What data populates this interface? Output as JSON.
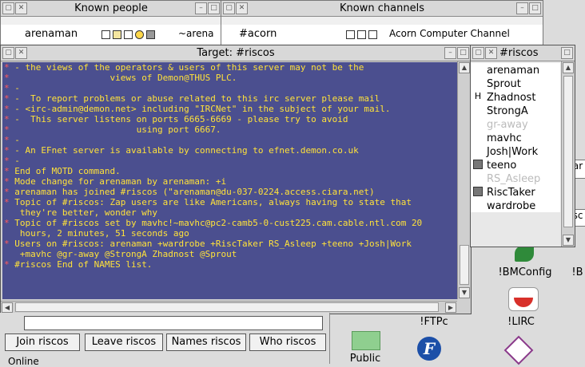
{
  "known_people": {
    "title": "Known people",
    "name": "arenaman",
    "nick_tail": "~arena"
  },
  "known_channels": {
    "title": "Known channels",
    "channel": "#acorn",
    "topic": "Acorn Computer Channel"
  },
  "target": {
    "title": "Target: #riscos"
  },
  "log_lines": [
    {
      "mark": "*",
      "text": " - the views of the operators & users of this server may not be the"
    },
    {
      "mark": "*",
      "text": "                   views of Demon@THUS PLC."
    },
    {
      "mark": "*",
      "text": " -"
    },
    {
      "mark": "*",
      "text": " -  To report problems or abuse related to this irc server please mail"
    },
    {
      "mark": "*",
      "text": " - <irc-admin@demon.net> including \"IRCNet\" in the subject of your mail."
    },
    {
      "mark": "*",
      "text": " -  This server listens on ports 6665-6669 - please try to avoid"
    },
    {
      "mark": "*",
      "text": "                        using port 6667."
    },
    {
      "mark": "*",
      "text": " -"
    },
    {
      "mark": "*",
      "text": " - An EFnet server is available by connecting to efnet.demon.co.uk"
    },
    {
      "mark": "*",
      "text": " -"
    },
    {
      "mark": "*",
      "text": " End of MOTD command."
    },
    {
      "mark": "*",
      "text": " Mode change for arenaman by arenaman: +i"
    },
    {
      "mark": "*",
      "text": " arenaman has joined #riscos (\"arenaman@du-037-0224.access.ciara.net)"
    },
    {
      "mark": "*",
      "text": " Topic of #riscos: Zap users are like Americans, always having to state that"
    },
    {
      "mark": "",
      "text": "   they're better, wonder why"
    },
    {
      "mark": "*",
      "text": " Topic of #riscos set by mavhc!~mavhc@pc2-camb5-0-cust225.cam.cable.ntl.com 20"
    },
    {
      "mark": "",
      "text": "   hours, 2 minutes, 51 seconds ago"
    },
    {
      "mark": "*",
      "text": " Users on #riscos: arenaman +wardrobe +RiscTaker RS_Asleep +teeno +Josh|Work"
    },
    {
      "mark": "",
      "text": "   +mavhc @gr-away @StrongA Zhadnost @Sprout"
    },
    {
      "mark": "*",
      "text": " #riscos End of NAMES list."
    }
  ],
  "users_panel": {
    "title": "#riscos"
  },
  "users": [
    {
      "name": "arenaman",
      "faint": false,
      "icon": ""
    },
    {
      "name": "Sprout",
      "faint": false,
      "icon": ""
    },
    {
      "name": "Zhadnost",
      "faint": false,
      "icon": "H"
    },
    {
      "name": "StrongA",
      "faint": false,
      "icon": ""
    },
    {
      "name": "gr-away",
      "faint": true,
      "icon": ""
    },
    {
      "name": "mavhc",
      "faint": false,
      "icon": ""
    },
    {
      "name": "Josh|Work",
      "faint": false,
      "icon": ""
    },
    {
      "name": "teeno",
      "faint": false,
      "icon": "monitor"
    },
    {
      "name": "RS_Asleep",
      "faint": true,
      "icon": ""
    },
    {
      "name": "RiscTaker",
      "faint": false,
      "icon": "monitor"
    },
    {
      "name": "wardrobe",
      "faint": false,
      "icon": ""
    }
  ],
  "buttons": {
    "join": "Join riscos",
    "leave": "Leave riscos",
    "names": "Names riscos",
    "who": "Who riscos"
  },
  "input": {
    "value": ""
  },
  "status_text": "Online",
  "desktop": {
    "bmconfig": "!BMConfig",
    "bmconfig_cut": "!B",
    "ftpc": "!FTPc",
    "lirc": "!LIRC",
    "public": "Public",
    "ar": "ar",
    "sc": "sc"
  }
}
